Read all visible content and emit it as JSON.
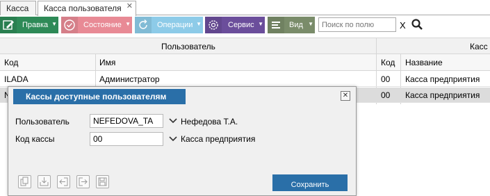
{
  "tabs": [
    {
      "label": "Касса"
    },
    {
      "label": "Касса пользователя",
      "close": "✕"
    }
  ],
  "toolbar": {
    "edit": "Правка",
    "state": "Состояние",
    "ops": "Операции",
    "service": "Сервис",
    "view": "Вид",
    "search_placeholder": "Поиск по полю",
    "clear": "X"
  },
  "grid": {
    "group_user": "Пользователь",
    "group_cash": "Касс",
    "columns": [
      "Код",
      "Имя",
      "Код",
      "Название"
    ],
    "rows": [
      {
        "code": "ILADA",
        "name": "Администратор",
        "cash_code": "00",
        "cash_name": "Касса предприятия"
      },
      {
        "code": "N",
        "name": "",
        "cash_code": "00",
        "cash_name": "Касса предприятия"
      }
    ]
  },
  "dialog": {
    "title": "Кассы доступные пользователям",
    "close": "✕",
    "user_label": "Пользователь",
    "user_value": "NEFEDOVA_TA",
    "user_desc": "Нефедова Т.А.",
    "cash_label": "Код кассы",
    "cash_value": "00",
    "cash_desc": "Касса предприятия",
    "save": "Сохранить"
  },
  "colors": {
    "edit": "#2e8a57",
    "state": "#e88a95",
    "ops": "#8dcbe8",
    "service": "#6b4e9b",
    "view": "#7a8c6a",
    "dialog_accent": "#2a6fa8"
  }
}
